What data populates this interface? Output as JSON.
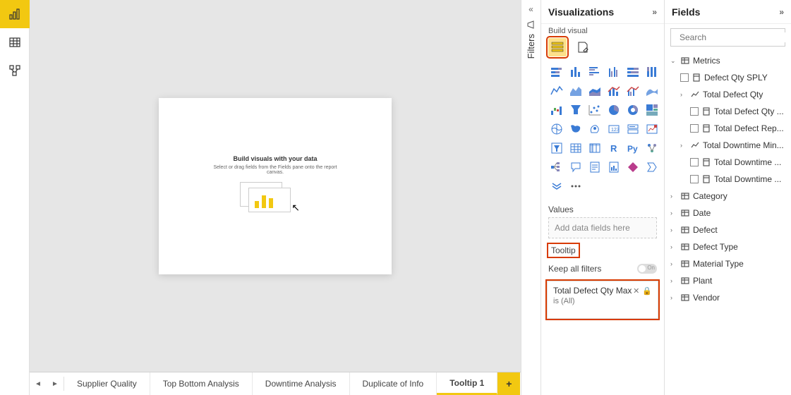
{
  "left_rail": {
    "items": [
      "report",
      "data",
      "model"
    ]
  },
  "canvas": {
    "placeholder_title": "Build visuals with your data",
    "placeholder_sub": "Select or drag fields from the Fields pane onto the report canvas."
  },
  "tabs": {
    "items": [
      "Supplier Quality",
      "Top Bottom Analysis",
      "Downtime Analysis",
      "Duplicate of Info",
      "Tooltip 1"
    ],
    "active": "Tooltip 1"
  },
  "filters_pane": {
    "label": "Filters"
  },
  "viz_pane": {
    "title": "Visualizations",
    "sub": "Build visual",
    "values_label": "Values",
    "values_placeholder": "Add data fields here",
    "tooltip_label": "Tooltip",
    "keep_filters_label": "Keep all filters",
    "toggle_state": "On",
    "filter_card": {
      "title": "Total Defect Qty Max",
      "sub": "is (All)"
    }
  },
  "fields_pane": {
    "title": "Fields",
    "search_placeholder": "Search",
    "tree": [
      {
        "type": "table",
        "label": "Metrics",
        "expanded": true,
        "children": [
          {
            "type": "measure-check",
            "label": "Defect Qty SPLY"
          },
          {
            "type": "measure-expand",
            "label": "Total Defect Qty",
            "children": [
              {
                "type": "measure-check",
                "label": "Total Defect Qty ..."
              },
              {
                "type": "measure-check",
                "label": "Total Defect Rep..."
              }
            ]
          },
          {
            "type": "measure-expand",
            "label": "Total Downtime Min...",
            "children": [
              {
                "type": "measure-check",
                "label": "Total Downtime ..."
              },
              {
                "type": "measure-check",
                "label": "Total Downtime ..."
              }
            ]
          }
        ]
      },
      {
        "type": "table",
        "label": "Category"
      },
      {
        "type": "table",
        "label": "Date"
      },
      {
        "type": "table",
        "label": "Defect"
      },
      {
        "type": "table",
        "label": "Defect Type"
      },
      {
        "type": "table",
        "label": "Material Type"
      },
      {
        "type": "table",
        "label": "Plant"
      },
      {
        "type": "table",
        "label": "Vendor"
      }
    ]
  }
}
